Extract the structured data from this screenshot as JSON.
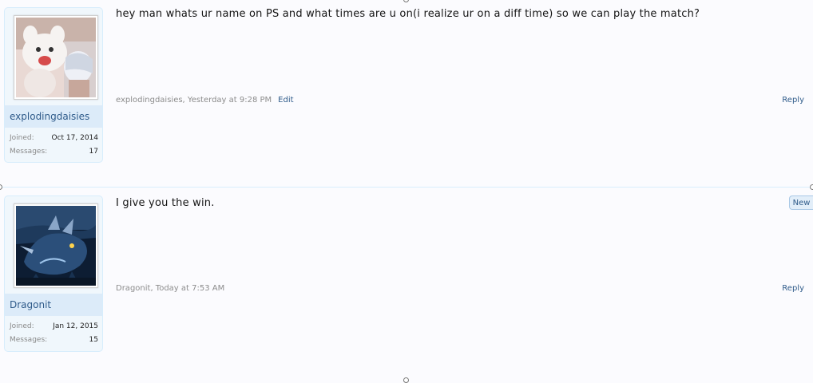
{
  "posts": [
    {
      "username": "explodingdaisies",
      "joined_label": "Joined:",
      "joined_value": "Oct 17, 2014",
      "messages_label": "Messages:",
      "messages_value": "17",
      "message": "hey man whats ur name on PS and what times are u on(i realize ur on a diff time) so we can play the match?",
      "author_time": "explodingdaisies, Yesterday at 9:28 PM",
      "edit_label": "Edit",
      "reply_label": "Reply"
    },
    {
      "username": "Dragonit",
      "joined_label": "Joined:",
      "joined_value": "Jan 12, 2015",
      "messages_label": "Messages:",
      "messages_value": "15",
      "message": "I give you the win.",
      "author_time": "Dragonit, Today at 7:53 AM",
      "reply_label": "Reply",
      "new_badge": "New"
    }
  ],
  "colors": {
    "link": "#2f5b8a",
    "username_bar": "#dcebf9",
    "panel_bg": "#f0f7fc",
    "page_bg": "#fbfbfe"
  }
}
